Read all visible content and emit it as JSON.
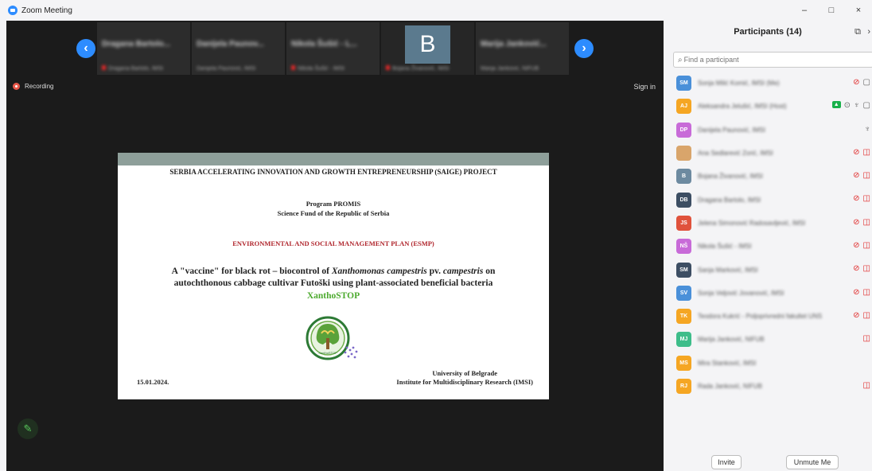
{
  "window": {
    "title": "Zoom Meeting",
    "minimize": "–",
    "maximize": "□",
    "close": "×"
  },
  "video_strip": {
    "tiles": [
      {
        "name": "Dragana Bartolo...",
        "sub": "Dragana Bartolo, IMSI"
      },
      {
        "name": "Danijela Paunov...",
        "sub": "Danijela Paunović, IMSI"
      },
      {
        "name": "Nikola Šušić - L...",
        "sub": "Nikola Šušić - IMSI"
      },
      {
        "name": "B",
        "sub": "Bojana Živanović, IMSI"
      },
      {
        "name": "Marija Janković...",
        "sub": "Marija Janković, NIFUB"
      }
    ]
  },
  "recording_label": "Recording",
  "sign_in_label": "Sign in",
  "slide": {
    "line1": "SERBIA ACCELERATING INNOVATION AND GROWTH ENTREPRENEURSHIP (SAIGE) PROJECT",
    "line2": "Program PROMIS",
    "line3": "Science Fund of the Republic of Serbia",
    "line4": "ENVIRONMENTAL AND SOCIAL MANAGEMENT PLAN (ESMP)",
    "line5a": "A \"vaccine\" for black rot – biocontrol of ",
    "line5b": "Xanthomonas campestris",
    "line5c": " pv. ",
    "line5d": "campestris",
    "line5e": " on",
    "line6": "autochthonous cabbage cultivar Futoški using plant-associated beneficial bacteria",
    "line7": "XanthoSTOP",
    "date": "15.01.2024.",
    "uni1": "University of Belgrade",
    "uni2": "Institute for Multidisciplinary Research (IMSI)"
  },
  "panel": {
    "title": "Participants (14)",
    "search_placeholder": "Find a participant",
    "invite_label": "Invite",
    "unmute_label": "Unmute Me",
    "participants": [
      {
        "initials": "SM",
        "color": "#4a90d9",
        "name": "Sonja Milić Komić, IMSI (Me)"
      },
      {
        "initials": "AJ",
        "color": "#f5a623",
        "name": "Aleksandra Jelušić, IMSI (Host)"
      },
      {
        "initials": "DP",
        "color": "#c86bd8",
        "name": "Danijela Paunović, IMSI"
      },
      {
        "initials": "",
        "color": "#d9a56b",
        "name": "Ana Sedlarević Zorić, IMSI"
      },
      {
        "initials": "B",
        "color": "#6d8aa0",
        "name": "Bojana Živanović, IMSI"
      },
      {
        "initials": "DB",
        "color": "#3d4e63",
        "name": "Dragana Bartolo, IMSI"
      },
      {
        "initials": "JS",
        "color": "#e0523c",
        "name": "Jelena Simonović Radosavljević, IMSI"
      },
      {
        "initials": "NŠ",
        "color": "#c86bd8",
        "name": "Nikola Šušić - IMSI"
      },
      {
        "initials": "SM",
        "color": "#3d4e63",
        "name": "Sanja Marković, IMSI"
      },
      {
        "initials": "SV",
        "color": "#4a90d9",
        "name": "Sonja Veljović Jovanović, IMSI"
      },
      {
        "initials": "TK",
        "color": "#f5a623",
        "name": "Teodora Kukrić - Poljoprivredni fakultet UNS"
      },
      {
        "initials": "MJ",
        "color": "#3ebd8a",
        "name": "Marija Janković, NIFUB"
      },
      {
        "initials": "MS",
        "color": "#f5a623",
        "name": "Mira Stanković, IMSI"
      },
      {
        "initials": "RJ",
        "color": "#f5a623",
        "name": "Rada Janković, NIFUB"
      }
    ]
  }
}
